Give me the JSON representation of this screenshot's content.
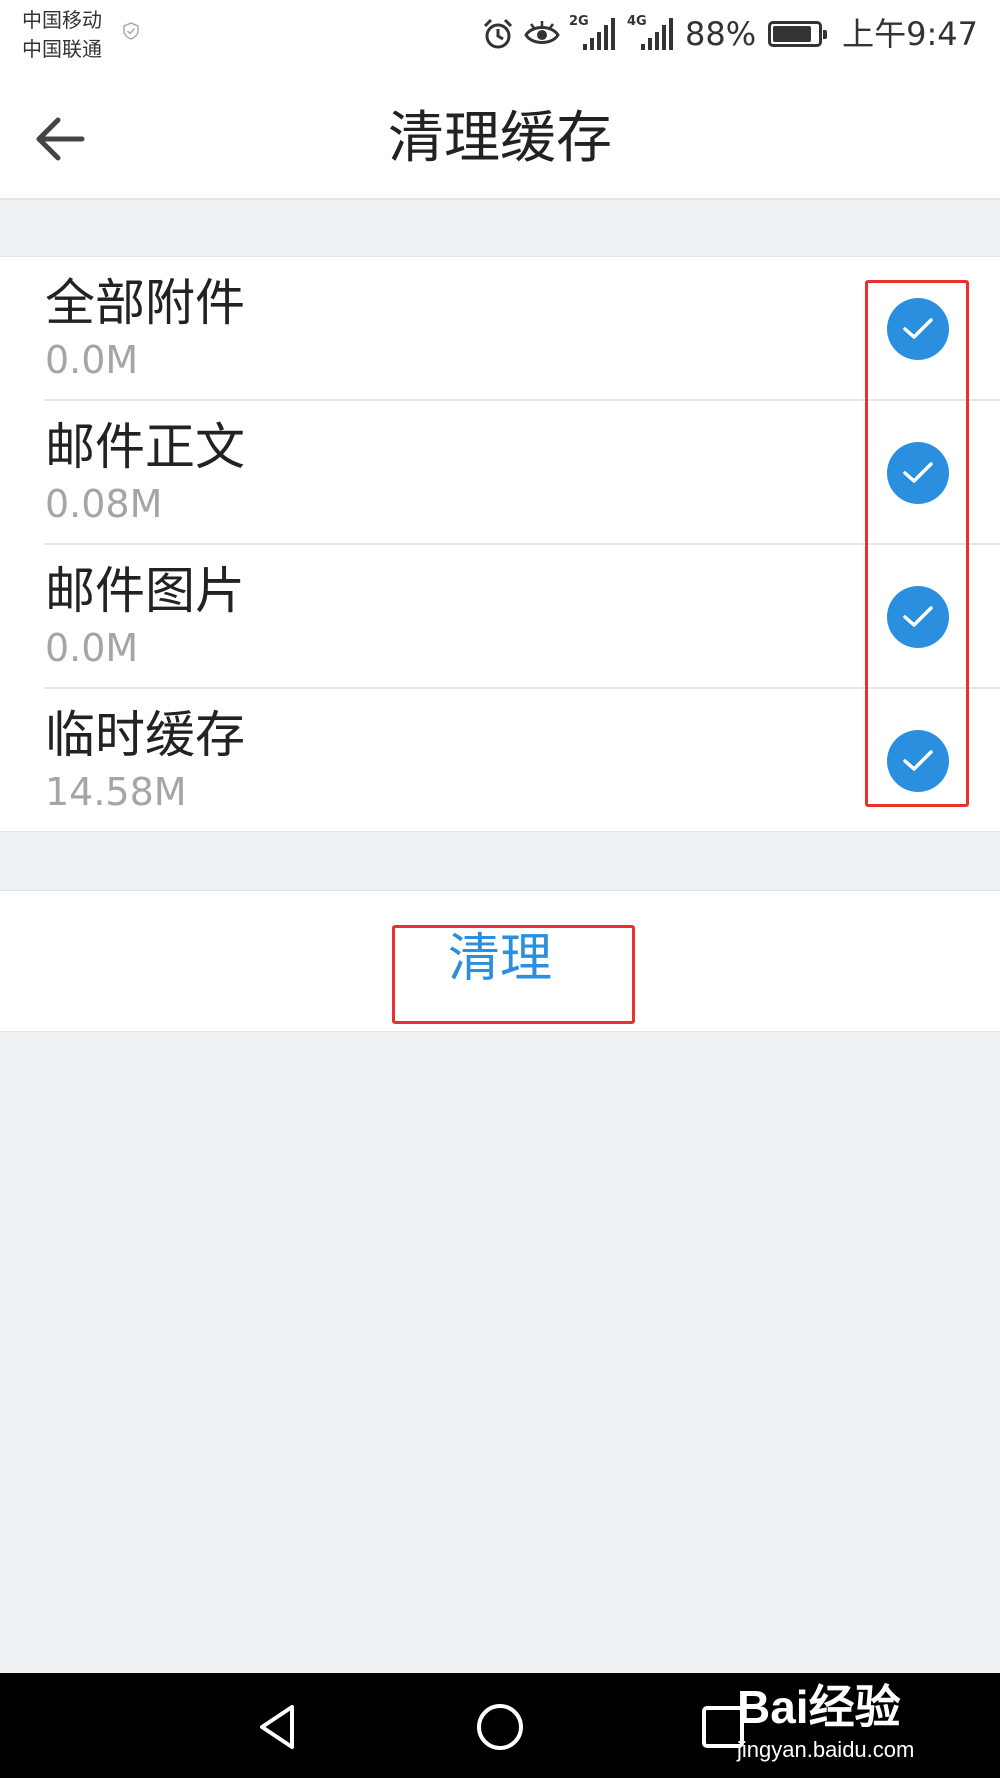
{
  "status_bar": {
    "carrier_1": "中国移动",
    "carrier_2": "中国联通",
    "net_1": "2G",
    "net_2": "4G",
    "battery_percent_text": "88%",
    "battery_level": 0.88,
    "time": "上午9:47",
    "icons": [
      "alarm-icon",
      "eye-icon",
      "signal-icon",
      "signal-icon",
      "battery-icon"
    ]
  },
  "header": {
    "back_icon": "arrow-left-icon",
    "title": "清理缓存"
  },
  "cache_items": [
    {
      "label": "全部附件",
      "size": "0.0M",
      "checked": true
    },
    {
      "label": "邮件正文",
      "size": "0.08M",
      "checked": true
    },
    {
      "label": "邮件图片",
      "size": "0.0M",
      "checked": true
    },
    {
      "label": "临时缓存",
      "size": "14.58M",
      "checked": true
    }
  ],
  "actions": {
    "clean_label": "清理"
  },
  "nav": {
    "icons": [
      "back-triangle-icon",
      "home-circle-icon",
      "recents-square-icon"
    ]
  },
  "watermark": {
    "logo": "Bai经验",
    "url": "jingyan.baidu.com"
  },
  "colors": {
    "accent": "#2b8fe0",
    "check": "#2b8fe0",
    "highlight": "#e8302e",
    "background": "#eff2f5"
  }
}
